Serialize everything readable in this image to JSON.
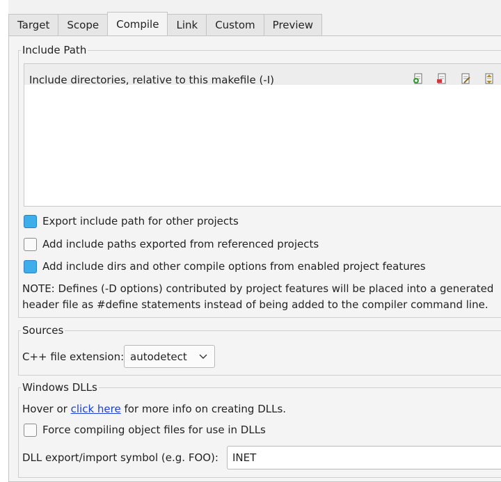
{
  "tabs": [
    "Target",
    "Scope",
    "Compile",
    "Link",
    "Custom",
    "Preview"
  ],
  "active_tab": "Compile",
  "include_path": {
    "group_title": "Include Path",
    "list_header": "Include directories, relative to this makefile (-I)",
    "header_icons": [
      "add-item-icon",
      "remove-item-icon",
      "edit-item-icon",
      "move-item-icon"
    ],
    "items": [],
    "export_label": "Export include path for other projects",
    "export_checked": true,
    "add_exported_label": "Add include paths exported from referenced projects",
    "add_exported_checked": false,
    "add_features_label": "Add include dirs and other compile options from enabled project features",
    "add_features_checked": true,
    "note": "NOTE: Defines (-D options) contributed by project features will be placed into a generated header file as #define statements instead of being added to the compiler command line."
  },
  "sources": {
    "group_title": "Sources",
    "cpp_ext_label": "C++ file extension:",
    "cpp_ext_value": "autodetect"
  },
  "windows_dlls": {
    "group_title": "Windows DLLs",
    "hover_prefix": "Hover or ",
    "link_text": "click here",
    "hover_suffix": " for more info on creating DLLs.",
    "force_label": "Force compiling object files for use in DLLs",
    "force_checked": false,
    "symbol_label": "DLL export/import symbol (e.g. FOO):",
    "symbol_value": "INET"
  },
  "colors": {
    "accent": "#3daee9",
    "link": "#1a3fd6",
    "panel_bg": "#f4f4f4"
  }
}
